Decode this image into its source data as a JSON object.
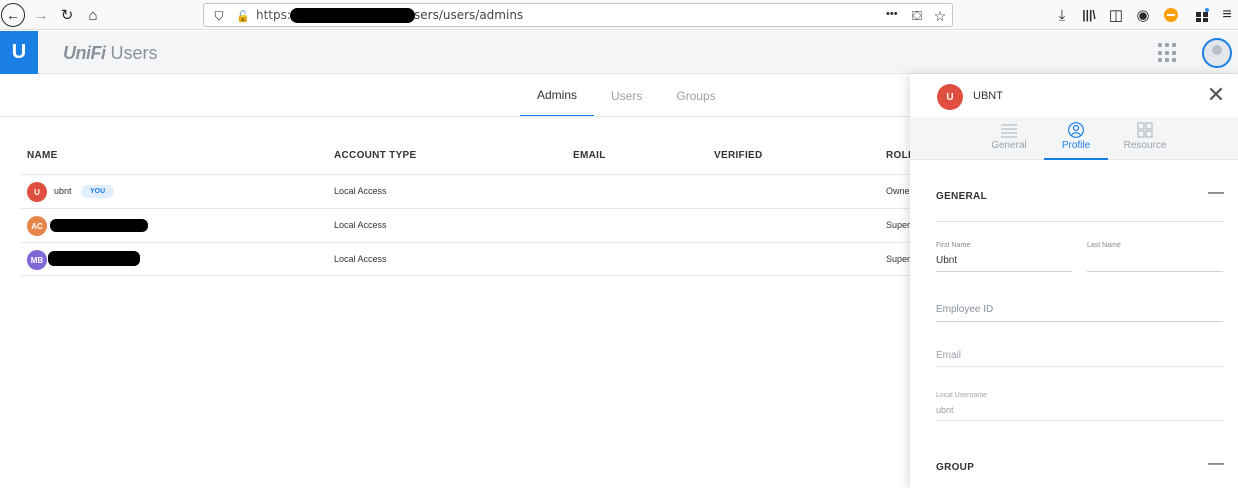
{
  "browser": {
    "url_prefix": "https://",
    "url_suffix": "sers/users/admins",
    "more_icon": "•••"
  },
  "app": {
    "logo_letter": "U",
    "title_brand": "UniFi",
    "title_rest": "Users"
  },
  "tabs": [
    {
      "label": "Admins",
      "active": true
    },
    {
      "label": "Users",
      "active": false
    },
    {
      "label": "Groups",
      "active": false
    }
  ],
  "table": {
    "headers": [
      "NAME",
      "ACCOUNT TYPE",
      "EMAIL",
      "VERIFIED",
      "ROLE"
    ],
    "rows": [
      {
        "initials": "U",
        "avatar_color": "#e04e3f",
        "name": "ubnt",
        "badge": "YOU",
        "account_type": "Local Access",
        "role": "Owne"
      },
      {
        "initials": "AC",
        "avatar_color": "#e5854a",
        "name": "",
        "badge": "",
        "account_type": "Local Access",
        "role": "Super"
      },
      {
        "initials": "MB",
        "avatar_color": "#7f67d6",
        "name": "",
        "badge": "",
        "account_type": "Local Access",
        "role": "Super"
      }
    ]
  },
  "panel": {
    "initial": "U",
    "name": "UBNT",
    "tabs": [
      {
        "label": "General",
        "icon": "list-icon",
        "active": false
      },
      {
        "label": "Profile",
        "icon": "person-icon",
        "active": true
      },
      {
        "label": "Resource",
        "icon": "grid-icon",
        "active": false
      }
    ],
    "general_title": "GENERAL",
    "first_name_label": "First Name",
    "first_name_value": "Ubnt",
    "last_name_label": "Last Name",
    "employee_id_placeholder": "Employee ID",
    "email_placeholder": "Email",
    "local_username_label": "Local Username",
    "local_username_value": "ubnt",
    "group_title": "GROUP"
  },
  "colors": {
    "accent": "#1a7fe5"
  }
}
